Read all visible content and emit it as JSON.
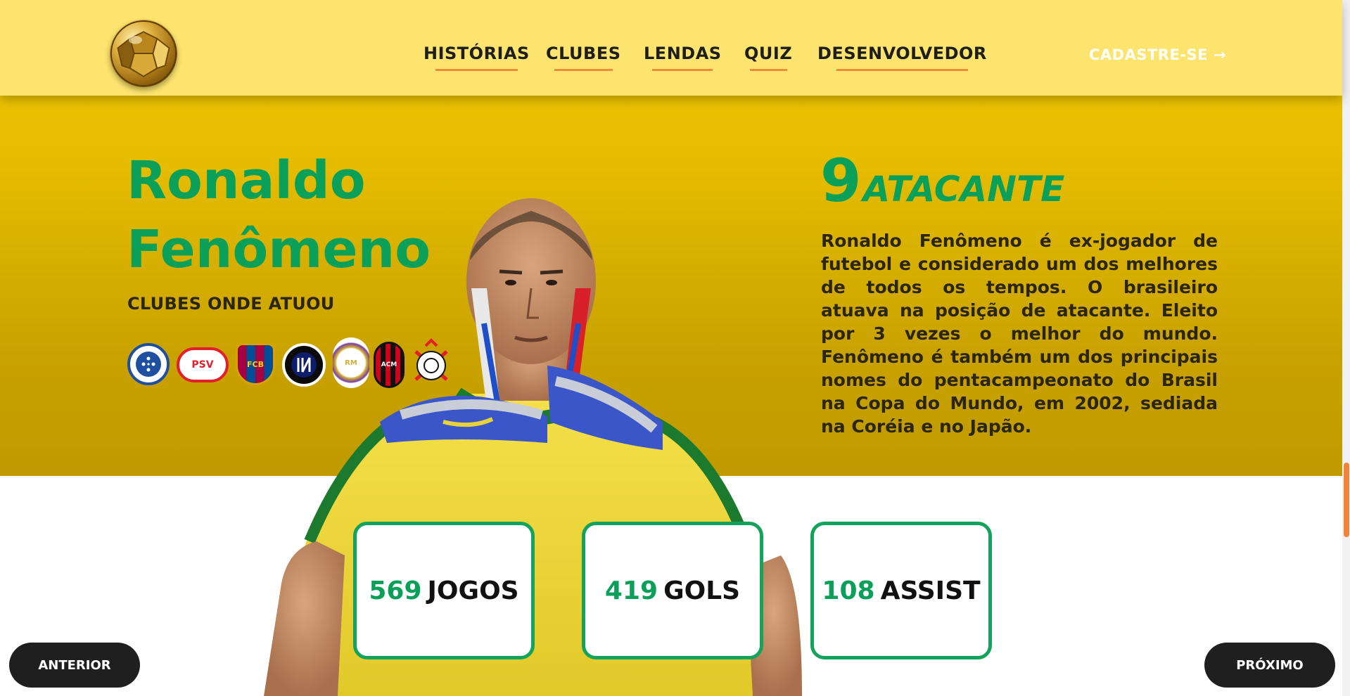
{
  "nav": {
    "logo_icon": "golden-ball-icon",
    "links": [
      {
        "label": "HISTÓRIAS"
      },
      {
        "label": "CLUBES"
      },
      {
        "label": "LENDAS"
      },
      {
        "label": "QUIZ"
      },
      {
        "label": "DESENVOLVEDOR"
      }
    ],
    "cta_label": "CADASTRE-SE",
    "cta_icon": "arrow-right-icon"
  },
  "player": {
    "name": "Ronaldo Fenômeno",
    "number": "9",
    "position": "ATACANTE",
    "clubs_label": "CLUBES ONDE ATUOU",
    "clubs": [
      {
        "icon": "cruzeiro-crest-icon",
        "color": "#1f4fa0"
      },
      {
        "icon": "psv-crest-icon",
        "color": "#e41e2b"
      },
      {
        "icon": "barcelona-crest-icon",
        "color": "#a50044"
      },
      {
        "icon": "inter-crest-icon",
        "color": "#0d1d6b"
      },
      {
        "icon": "real-madrid-crest-icon",
        "color": "#d4af37"
      },
      {
        "icon": "milan-crest-icon",
        "color": "#d0021b"
      },
      {
        "icon": "corinthians-crest-icon",
        "color": "#e41e2b"
      }
    ],
    "bio": "Ronaldo Fenômeno é ex-jogador de futebol e considerado um dos melhores de todos os tempos. O brasileiro atuava na posição de atacante. Eleito por 3 vezes o melhor do mundo. Fenômeno é também um dos principais nomes do pentacampeonato do Brasil na Copa do Mundo, em 2002, sediada na Coréia e no Japão.",
    "photo": "player-photo"
  },
  "stats": [
    {
      "value": "569",
      "label": "JOGOS"
    },
    {
      "value": "419",
      "label": "GOLS"
    },
    {
      "value": "108",
      "label": "ASSIST"
    }
  ],
  "pager": {
    "prev_label": "ANTERIOR",
    "next_label": "PRÓXIMO"
  },
  "colors": {
    "accent_green": "#0aa05a",
    "hero_yellow": "#e5bc00",
    "navbar_yellow": "#fde46e",
    "underline_orange": "#f28a3a"
  }
}
